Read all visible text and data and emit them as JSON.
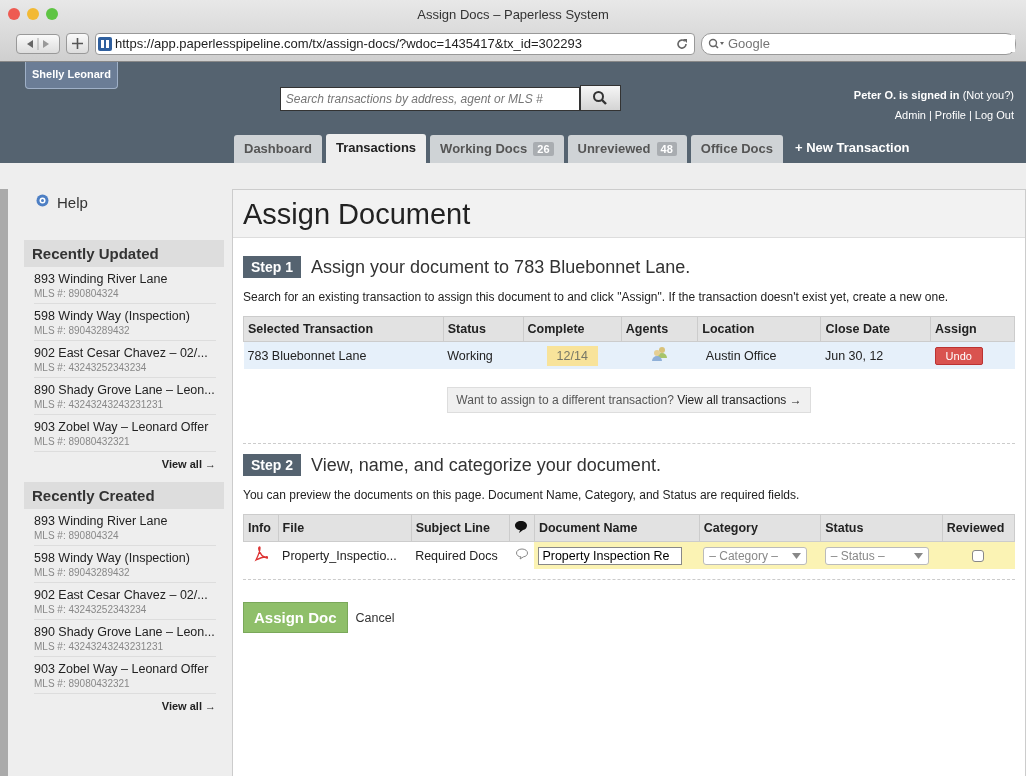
{
  "browser": {
    "title": "Assign Docs – Paperless System",
    "url": "https://app.paperlesspipeline.com/tx/assign-docs/?wdoc=1435417&tx_id=302293",
    "search_placeholder": "Google"
  },
  "header": {
    "user_badge": "Shelly Leonard",
    "search_placeholder": "Search transactions by address, agent or MLS #",
    "signed_in": "Peter O. is signed in",
    "not_you": "(Not you?)",
    "links": [
      "Admin",
      "Profile",
      "Log Out"
    ],
    "link_separator": "|"
  },
  "tabs": [
    {
      "label": "Dashboard",
      "selected": false
    },
    {
      "label": "Transactions",
      "selected": true
    },
    {
      "label": "Working Docs",
      "count": "26",
      "selected": false
    },
    {
      "label": "Unreviewed",
      "count": "48",
      "selected": false
    },
    {
      "label": "Office Docs",
      "selected": false
    }
  ],
  "new_transaction": "+ New Transaction",
  "sidebar": {
    "help": "Help",
    "sections": [
      {
        "title": "Recently Updated",
        "items": [
          {
            "name": "893 Winding River Lane",
            "mls": "MLS #: 890804324"
          },
          {
            "name": "598 Windy Way (Inspection)",
            "mls": "MLS #: 89043289432"
          },
          {
            "name": "902 East Cesar Chavez – 02/...",
            "mls": "MLS #: 43243252343234"
          },
          {
            "name": "890 Shady Grove Lane – Leon...",
            "mls": "MLS #: 43243243243231231"
          },
          {
            "name": "903 Zobel Way – Leonard Offer",
            "mls": "MLS #: 89080432321"
          }
        ],
        "view_all": "View all →"
      },
      {
        "title": "Recently Created",
        "items": [
          {
            "name": "893 Winding River Lane",
            "mls": "MLS #: 890804324"
          },
          {
            "name": "598 Windy Way (Inspection)",
            "mls": "MLS #: 89043289432"
          },
          {
            "name": "902 East Cesar Chavez – 02/...",
            "mls": "MLS #: 43243252343234"
          },
          {
            "name": "890 Shady Grove Lane – Leon...",
            "mls": "MLS #: 43243243243231231"
          },
          {
            "name": "903 Zobel Way – Leonard Offer",
            "mls": "MLS #: 89080432321"
          }
        ],
        "view_all": "View all →"
      }
    ]
  },
  "main": {
    "title": "Assign Document",
    "step1": {
      "badge": "Step 1",
      "heading": "Assign your document to 783 Bluebonnet Lane.",
      "description": "Search for an existing transaction to assign this document to and click \"Assign\". If the transaction doesn't exist yet, create a new one.",
      "columns": [
        "Selected Transaction",
        "Status",
        "Complete",
        "Agents",
        "Location",
        "Close Date",
        "Assign"
      ],
      "rows": [
        {
          "transaction": "783 Bluebonnet Lane",
          "status": "Working",
          "complete": "12/14",
          "location": "Austin Office",
          "close_date": "Jun 30, 12",
          "action": "Undo",
          "selected": true
        }
      ],
      "different_text": "Want to assign to a different transaction?",
      "different_link": "View all transactions →"
    },
    "step2": {
      "badge": "Step 2",
      "heading": "View, name, and categorize your document.",
      "description": "You can preview the documents on this page. Document Name, Category, and Status are required fields.",
      "columns": [
        {
          "kind": "text",
          "label": "Info"
        },
        {
          "kind": "text",
          "label": "File"
        },
        {
          "kind": "text",
          "label": "Subject Line"
        },
        {
          "kind": "icon"
        },
        {
          "kind": "text",
          "label": "Document Name"
        },
        {
          "kind": "text",
          "label": "Category"
        },
        {
          "kind": "text",
          "label": "Status"
        },
        {
          "kind": "text",
          "label": "Reviewed"
        }
      ],
      "rows": [
        {
          "file": "Property_Inspectio...",
          "subject": "Required Docs",
          "document_name": "Property Inspection Re",
          "category": "– Category –",
          "status": "– Status –",
          "reviewed": false
        }
      ]
    },
    "assign_button": "Assign Doc",
    "cancel": "Cancel"
  }
}
